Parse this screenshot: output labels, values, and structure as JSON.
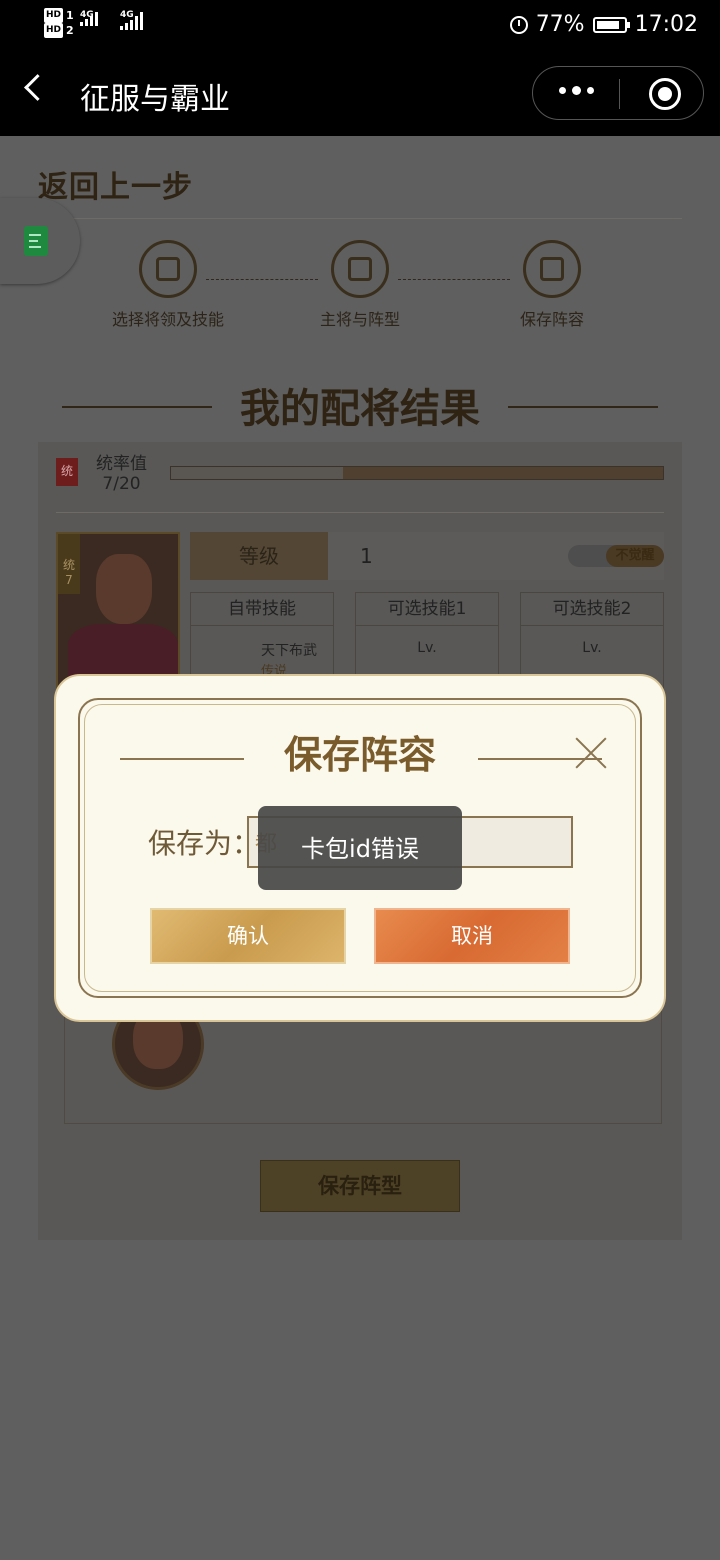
{
  "status_bar": {
    "hd1": "HD",
    "hd1_num": "1",
    "hd2": "HD",
    "hd2_num": "2",
    "net1": "4G",
    "net2": "4G",
    "battery": "77%",
    "time": "17:02",
    "icons": [
      "alarm-icon",
      "battery-icon"
    ]
  },
  "navbar": {
    "title": "征服与霸业",
    "icons": [
      "back-icon",
      "more-icon",
      "close-miniprogram-icon"
    ]
  },
  "page": {
    "back_step": "返回上一步",
    "steps": [
      {
        "label": "选择将领及技能",
        "icon": "helmet-icon"
      },
      {
        "label": "主将与阵型",
        "icon": "formation-icon"
      },
      {
        "label": "保存阵容",
        "icon": "save-icon"
      }
    ],
    "result_title": "我的配将结果",
    "command": {
      "badge": "统",
      "label": "统率值",
      "value": "7/20",
      "progress": 0.35
    },
    "general": {
      "tag_char": "统",
      "tag_num": "7",
      "stars": "★★★★★",
      "level_label": "等级",
      "level_value": "1",
      "awaken_label": "不觉醒"
    },
    "skills": [
      {
        "header": "自带技能",
        "name": "天下布武",
        "grade": "传说"
      },
      {
        "header": "可选技能1",
        "name": "Lv.",
        "grade": ""
      },
      {
        "header": "可选技能2",
        "name": "Lv.",
        "grade": ""
      }
    ],
    "save_formation": "保存阵型"
  },
  "modal": {
    "title": "保存阵容",
    "save_as_label": "保存为：",
    "input_value": "都",
    "confirm": "确认",
    "cancel": "取消"
  },
  "toast": {
    "message": "卡包id错误"
  }
}
